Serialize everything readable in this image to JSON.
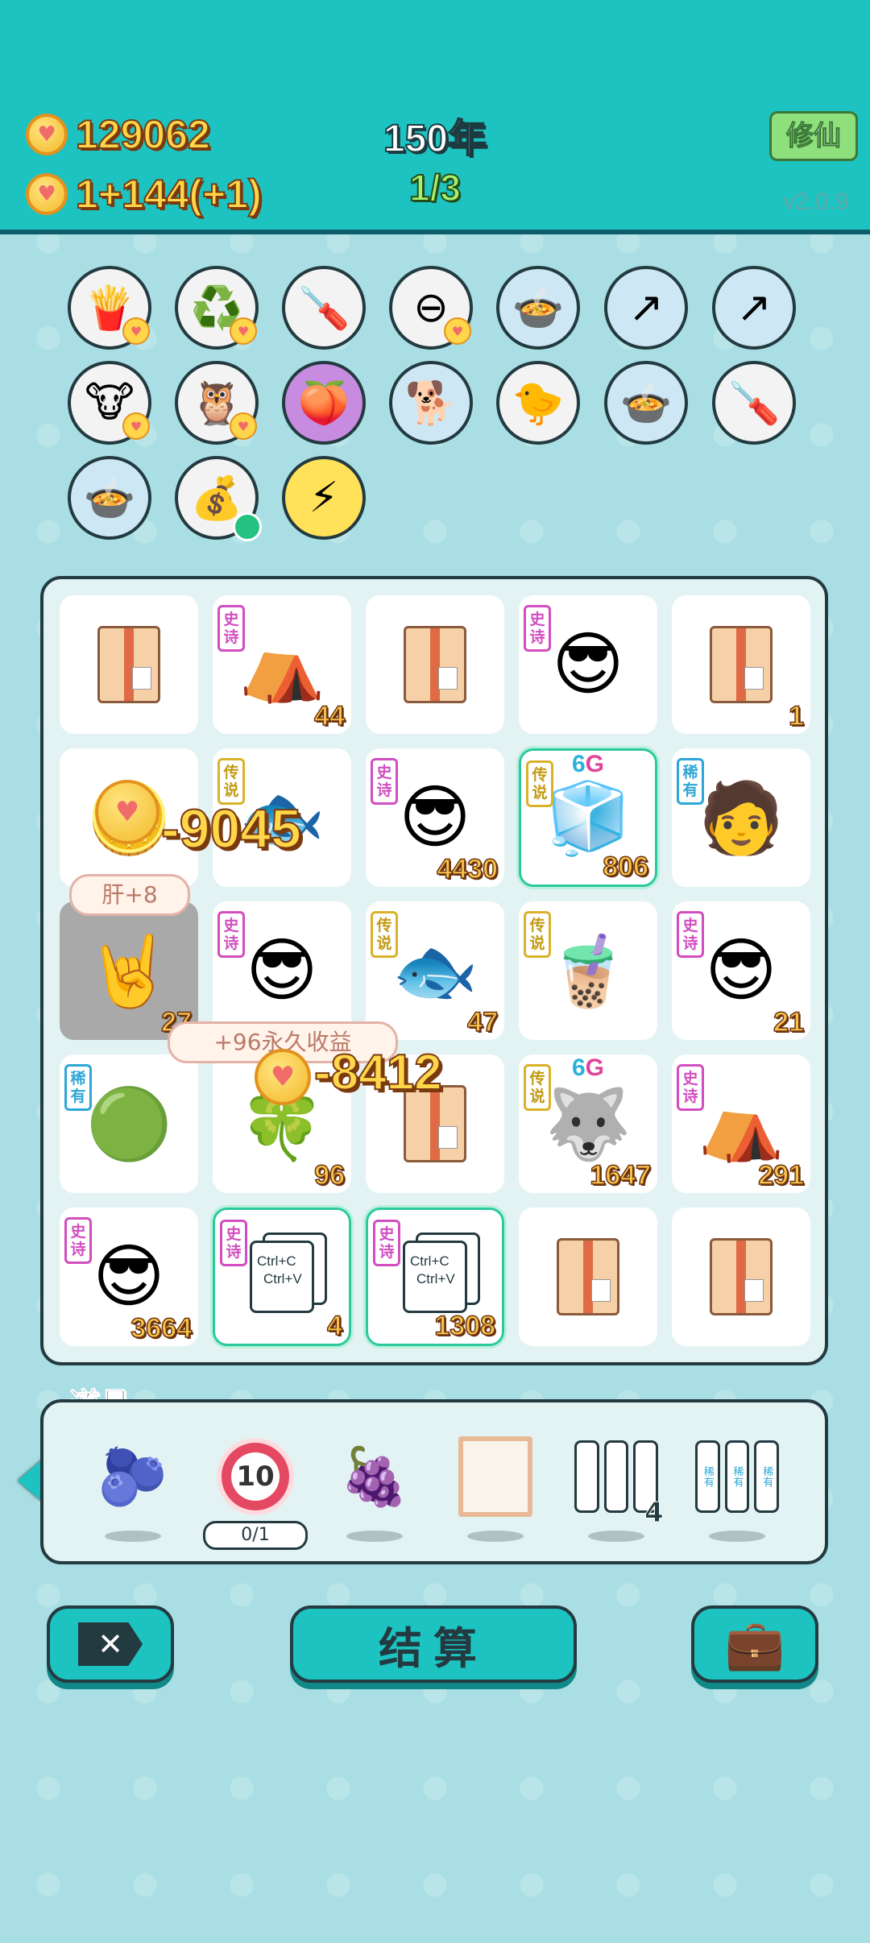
{
  "colors": {
    "topbar": "#1dc3c1",
    "background": "#a9dfe4",
    "accent": "#233a40"
  },
  "hud": {
    "coins": "129062",
    "income": "1+144(+1)",
    "year": "150年",
    "round": "1/3",
    "xiuxian_label": "修仙",
    "version": "v2.0.9"
  },
  "relics": [
    {
      "icon": "fries-icon",
      "emoji": "🍟"
    },
    {
      "icon": "recycle-icon",
      "emoji": "♻️"
    },
    {
      "icon": "screwdriver-icon",
      "emoji": "🪛"
    },
    {
      "icon": "minus-circle-icon",
      "emoji": "⊖"
    },
    {
      "icon": "duck-pot-icon",
      "emoji": "🍲"
    },
    {
      "icon": "arrow-up-card-icon",
      "emoji": "↗"
    },
    {
      "icon": "arrow-up-card-icon",
      "emoji": "↗"
    },
    {
      "icon": "twin-cows-icon",
      "emoji": "🐮"
    },
    {
      "icon": "owls-icon",
      "emoji": "🦉"
    },
    {
      "icon": "eyepatch-fruit-icon",
      "emoji": "🍑"
    },
    {
      "icon": "cool-dog-icon",
      "emoji": "🐕"
    },
    {
      "icon": "chick-egg-icon",
      "emoji": "🐤"
    },
    {
      "icon": "duck-pot-icon",
      "emoji": "🍲"
    },
    {
      "icon": "screwdriver-icon",
      "emoji": "🪛"
    },
    {
      "icon": "duck-pot-icon",
      "emoji": "🍲"
    },
    {
      "icon": "money-bag-icon",
      "emoji": "💰"
    },
    {
      "icon": "lightning-icon",
      "emoji": "⚡"
    }
  ],
  "board": {
    "cells": [
      {
        "icon": "cardboard-box-icon",
        "tag": "",
        "count": ""
      },
      {
        "icon": "rabbit-tent-icon",
        "tag": "史诗",
        "count": "44"
      },
      {
        "icon": "cardboard-box-icon",
        "tag": "",
        "count": ""
      },
      {
        "icon": "green-hat-face-icon",
        "tag": "史诗",
        "count": ""
      },
      {
        "icon": "cardboard-box-icon",
        "tag": "",
        "count": "1"
      },
      {
        "icon": "coin-pile-icon",
        "tag": "",
        "count": ""
      },
      {
        "icon": "koi-fish-icon",
        "tag": "传说",
        "count": ""
      },
      {
        "icon": "green-hat-face-icon",
        "tag": "史诗",
        "count": "4430"
      },
      {
        "icon": "crowned-fridge-icon",
        "tag": "传说",
        "count": "806"
      },
      {
        "icon": "bucket-hat-man-icon",
        "tag": "稀有",
        "count": ""
      },
      {
        "icon": "rock-hand-icon",
        "tag": "",
        "count": "27"
      },
      {
        "icon": "green-hat-face-icon",
        "tag": "史诗",
        "count": ""
      },
      {
        "icon": "koi-fish-icon",
        "tag": "传说",
        "count": "47"
      },
      {
        "icon": "bubble-tea-icon",
        "tag": "传说",
        "count": ""
      },
      {
        "icon": "green-hat-face-icon",
        "tag": "史诗",
        "count": "21"
      },
      {
        "icon": "green-slime-icon",
        "tag": "稀有",
        "count": ""
      },
      {
        "icon": "clover-box-icon",
        "tag": "",
        "count": "96"
      },
      {
        "icon": "cardboard-box-icon",
        "tag": "",
        "count": ""
      },
      {
        "icon": "crowned-husky-icon",
        "tag": "传说",
        "count": "1647"
      },
      {
        "icon": "rabbit-tent-icon",
        "tag": "史诗",
        "count": "291"
      },
      {
        "icon": "green-hat-face-icon",
        "tag": "史诗",
        "count": "3664"
      },
      {
        "icon": "ctrl-c-v-cards-icon",
        "tag": "史诗",
        "count": "4"
      },
      {
        "icon": "ctrl-c-v-cards-icon",
        "tag": "史诗",
        "count": "1308"
      },
      {
        "icon": "cardboard-box-icon",
        "tag": "",
        "count": ""
      },
      {
        "icon": "cardboard-box-icon",
        "tag": "",
        "count": ""
      }
    ],
    "sixg_label": {
      "six": "6",
      "g": "G"
    },
    "ctrl_text": {
      "line1": "Ctrl+C",
      "line2": "Ctrl+V"
    },
    "floaters": {
      "neg1": "-9045",
      "neg2": "-8412",
      "pill1": "肝+8",
      "pill2": "+96永久收益"
    }
  },
  "items_panel": {
    "title": "道具",
    "items": [
      {
        "icon": "blueberry-icon",
        "label": ""
      },
      {
        "icon": "ten-ball-icon",
        "label": "10",
        "counter": "0/1"
      },
      {
        "icon": "lychee-icon",
        "label": ""
      },
      {
        "icon": "empty-frame-icon",
        "label": ""
      },
      {
        "icon": "three-slots-icon",
        "label": "4"
      },
      {
        "icon": "rare-slots-icon",
        "label": "稀有"
      }
    ]
  },
  "buttons": {
    "cancel_icon": "✕",
    "settle_label": "结算",
    "bag_icon": "💼"
  }
}
